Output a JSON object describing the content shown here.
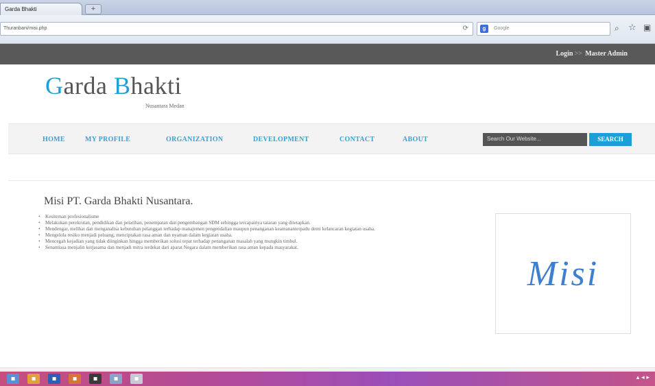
{
  "browser": {
    "tab_title": "Garda Bhakti",
    "new_tab_label": "+",
    "url": "Thuranbani/misi.php",
    "search_placeholder": "Google",
    "icons": [
      "reload-icon",
      "google-icon",
      "search-icon",
      "star-icon",
      "bookmark-icon"
    ]
  },
  "topbar": {
    "login_label": "Login",
    "separator": ">>",
    "admin_label": "Master Admin"
  },
  "header": {
    "logo_first_cap": "G",
    "logo_first_rest": "arda ",
    "logo_second_cap": "B",
    "logo_second_rest": "hakti",
    "tagline": "Nusantara Medan",
    "accent_color": "#1c9fd6"
  },
  "nav": {
    "items": [
      "HOME",
      "MY PROFILE",
      "ORGANIZATION",
      "DEVELOPMENT",
      "CONTACT",
      "ABOUT"
    ],
    "search_placeholder": "Search Our Website...",
    "search_button": "SEARCH"
  },
  "content": {
    "title": "Misi PT. Garda Bhakti Nusantara.",
    "missions": [
      "Kesiteman profesionalisme",
      "Melakukan perekrutan, pendidikan dan pelatihan, penempatan dan pengembangan SDM sehingga tercapainya tataran yang ditetapkan.",
      "Mendengar, melihat dan menganalisa kebutuhan pelanggan terhadap manajemen pengendalian maupun penanganan keamananterpadu demi kelancaran kegiatan usaha.",
      "Mengelola resiko menjadi peluang, menciptakan rasa aman dan nyaman dalam kegiatan usaha.",
      "Mencegah kejadian yang tidak diinginkan hingga memberikan solusi tepat terhadap penanganan masalah yang mungkin timbul.",
      "Senantiasa menjalin kerjasama dan menjadi mitra terdekat dari aparat Negara dalam memberikan rasa aman kepada masyarakat."
    ],
    "image_word": "Misi"
  }
}
